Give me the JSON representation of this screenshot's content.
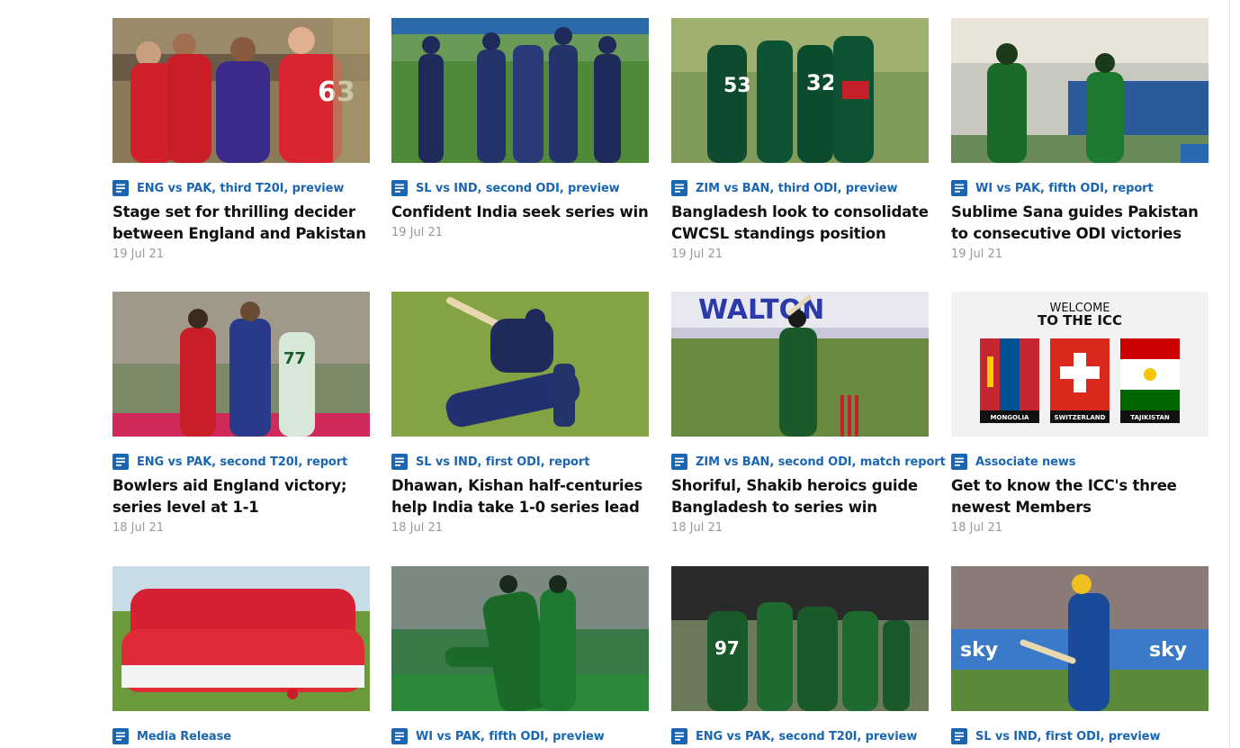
{
  "articles": [
    {
      "tag": "ENG vs PAK, third T20I, preview",
      "headline": "Stage set for thrilling decider between England and Pakistan",
      "date": "19 Jul 21",
      "image": "england-team-celebration-photo"
    },
    {
      "tag": "SL vs IND, second ODI, preview",
      "headline": "Confident India seek series win",
      "date": "19 Jul 21",
      "image": "india-team-huddle-photo"
    },
    {
      "tag": "ZIM vs BAN, third ODI, preview",
      "headline": "Bangladesh look to consolidate CWCSL standings position",
      "date": "19 Jul 21",
      "image": "bangladesh-players-walking-photo"
    },
    {
      "tag": "WI vs PAK, fifth ODI, report",
      "headline": "Sublime Sana guides Pakistan to consecutive ODI victories",
      "date": "19 Jul 21",
      "image": "pakistan-women-batters-photo"
    },
    {
      "tag": "ENG vs PAK, second T20I, report",
      "headline": "Bowlers aid England victory; series level at 1-1",
      "date": "18 Jul 21",
      "image": "england-wicket-celebration-photo"
    },
    {
      "tag": "SL vs IND, first ODI, report",
      "headline": "Dhawan, Kishan half-centuries help India take 1-0 series lead",
      "date": "18 Jul 21",
      "image": "india-batter-sweep-shot-photo"
    },
    {
      "tag": "ZIM vs BAN, second ODI, match report",
      "headline": "Shoriful, Shakib heroics guide Bangladesh to series win",
      "date": "18 Jul 21",
      "image": "bangladesh-batter-photo"
    },
    {
      "tag": "Associate news",
      "headline": "Get to know the ICC's three newest Members",
      "date": "18 Jul 21",
      "image": "new-members-flags-graphic",
      "graphic": {
        "title_line1": "WELCOME",
        "title_line2": "TO THE ICC",
        "flags": [
          "MONGOLIA",
          "SWITZERLAND",
          "TAJIKISTAN"
        ]
      }
    },
    {
      "tag": "Media Release",
      "headline": "",
      "date": "",
      "image": "red-team-group-photo"
    },
    {
      "tag": "WI vs PAK, fifth ODI, preview",
      "headline": "",
      "date": "",
      "image": "pakistan-women-celebration-photo"
    },
    {
      "tag": "ENG vs PAK, second T20I, preview",
      "headline": "",
      "date": "",
      "image": "pakistan-team-celebration-photo"
    },
    {
      "tag": "SL vs IND, first ODI, preview",
      "headline": "",
      "date": "",
      "image": "sri-lanka-batter-photo"
    }
  ],
  "colors": {
    "tag": "#1a66b3",
    "headline": "#111111",
    "date": "#9a9a9a",
    "icon": "#1a66b3"
  }
}
